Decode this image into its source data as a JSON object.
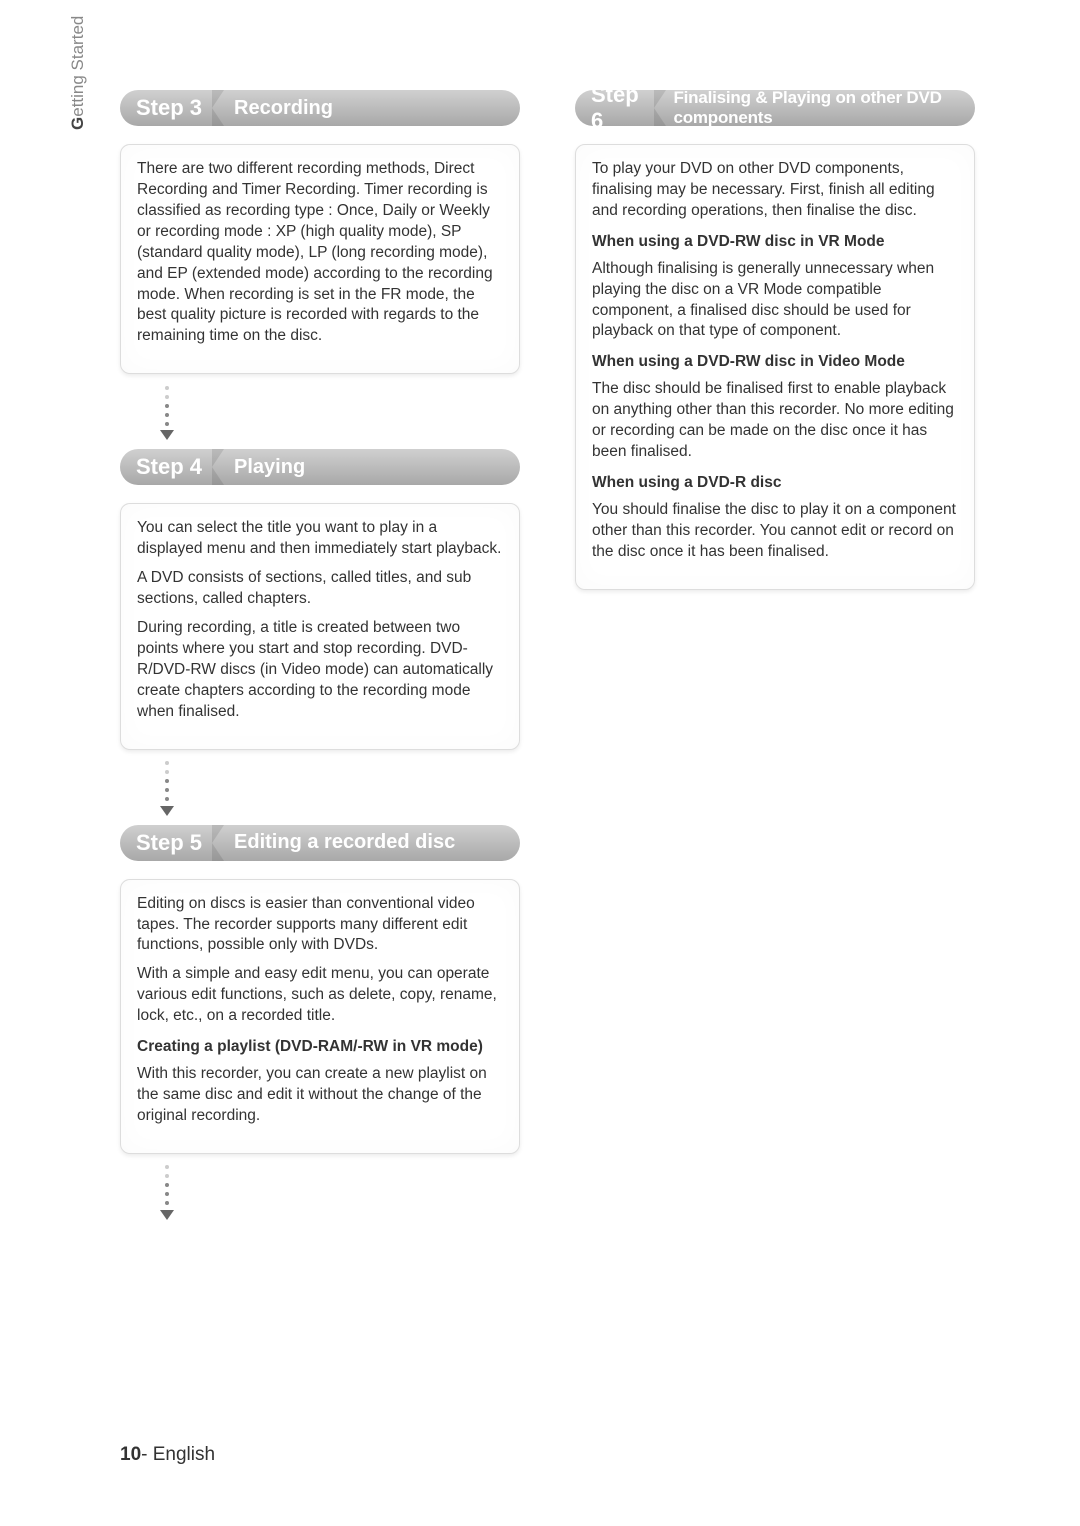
{
  "sideLabel": {
    "bold": "G",
    "rest": "etting Started"
  },
  "footer": {
    "page": "10",
    "sep": "- ",
    "lang": "English"
  },
  "left": {
    "step3": {
      "num": "Step 3",
      "title": "Recording",
      "body": "There are two different recording methods, Direct Recording and Timer Recording. Timer recording is classified as recording type : Once, Daily or Weekly or recording mode : XP (high quality mode), SP (standard quality mode), LP (long recording mode), and EP (extended mode) according to the recording mode. When recording is set in the FR mode, the best quality picture is recorded with regards to the remaining time on the disc."
    },
    "step4": {
      "num": "Step 4",
      "title": "Playing",
      "body1": "You can select the title you want to play in a displayed menu and then immediately start playback.",
      "body2": "A DVD consists of sections, called titles, and sub sections, called chapters.",
      "body3": "During recording, a title is created between two points where you start and stop recording. DVD-R/DVD-RW discs (in Video mode) can automatically create chapters according to the recording mode when finalised."
    },
    "step5": {
      "num": "Step 5",
      "title": "Editing a recorded disc",
      "body1": "Editing on discs is easier than conventional video tapes. The recorder supports many different edit functions, possible only with DVDs.",
      "body2": "With a simple and easy edit menu, you can operate various edit functions, such as delete, copy, rename, lock, etc., on a recorded title.",
      "sub1": "Creating a playlist (DVD-RAM/-RW in VR mode)",
      "body3": "With this recorder, you can create a new playlist on the same disc and edit it without the change of the original recording."
    }
  },
  "right": {
    "step6": {
      "num": "Step 6",
      "title": "Finalising & Playing on other DVD components",
      "intro": "To play your DVD on other DVD components, finalising may be necessary. First, finish all editing and recording operations, then finalise the disc.",
      "h1": "When using a DVD-RW disc in VR Mode",
      "p1": "Although finalising is generally unnecessary when playing the disc on a VR Mode compatible component, a finalised disc should be used for playback on that type of component.",
      "h2": "When using a DVD-RW disc in Video Mode",
      "p2": "The disc should be finalised first to enable playback on anything other than this recorder. No more editing or recording can be made on the disc once it has been finalised.",
      "h3": "When using a DVD-R disc",
      "p3": "You should finalise the disc to play it on a component other than this recorder. You cannot edit or record on the disc once it has been finalised."
    }
  }
}
